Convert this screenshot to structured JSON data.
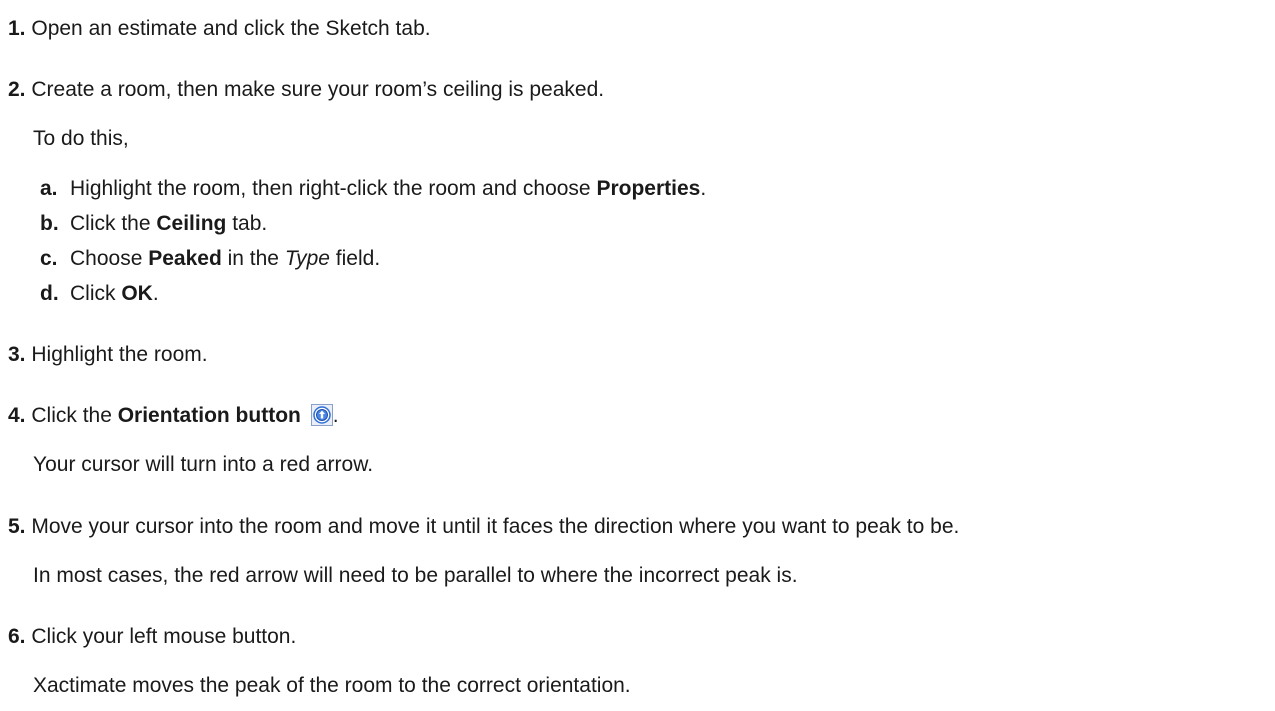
{
  "steps": {
    "s1": {
      "num": "1.",
      "text": "Open an estimate and click the Sketch tab."
    },
    "s2": {
      "num": "2.",
      "text": "Create a room, then make sure your room’s ceiling is peaked."
    },
    "s2_intro": "To do this,",
    "s2a": {
      "letter": "a.",
      "pre": "Highlight the room, then right-click the room and choose ",
      "bold": "Properties",
      "post": "."
    },
    "s2b": {
      "letter": "b.",
      "pre": "Click the ",
      "bold": "Ceiling",
      "post": " tab."
    },
    "s2c": {
      "letter": "c.",
      "pre": "Choose ",
      "bold": "Peaked",
      "mid": " in the ",
      "italic": "Type",
      "post": " field."
    },
    "s2d": {
      "letter": "d.",
      "pre": "Click ",
      "bold": "OK",
      "post": "."
    },
    "s3": {
      "num": "3.",
      "text": "Highlight the room."
    },
    "s4": {
      "num": "4.",
      "pre": "Click the ",
      "bold": "Orientation button",
      "post": "."
    },
    "s4_note": "Your cursor will turn into a red arrow.",
    "s5": {
      "num": "5.",
      "text": "Move your cursor into the room and move it until it faces the direction where you want to peak to be."
    },
    "s5_note": "In most cases, the red arrow will need to be parallel to where the incorrect peak is.",
    "s6": {
      "num": "6.",
      "text": "Click your left mouse button."
    },
    "s6_note": "Xactimate moves the peak of the room to the correct orientation."
  },
  "icon": {
    "name": "orientation-icon",
    "accent": "#2f6fd6"
  }
}
